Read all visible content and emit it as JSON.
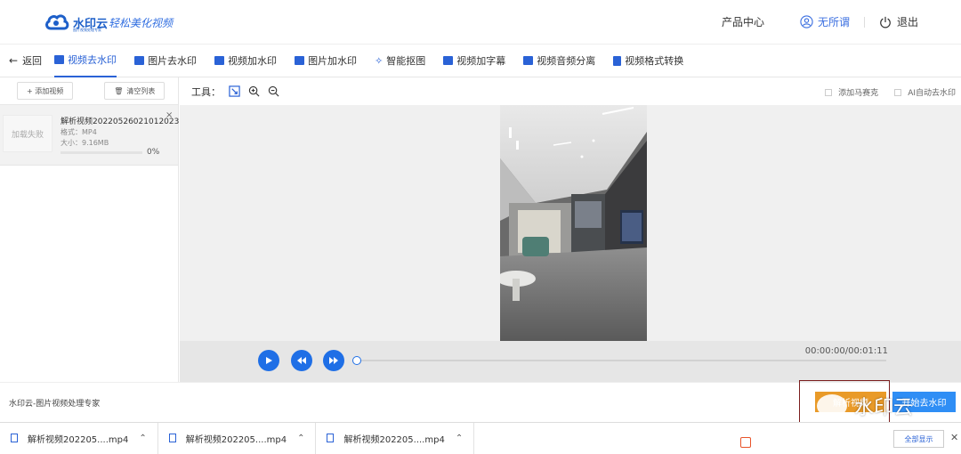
{
  "header": {
    "logo_text": "水印云",
    "logo_sub": "图片视频处理专家",
    "slogan": "轻松美化视频",
    "product_center": "产品中心",
    "username": "无所谓",
    "logout": "退出",
    "accent_color": "#2a62d6"
  },
  "tabs": {
    "back": "返回",
    "items": [
      {
        "label": "视频去水印",
        "icon": "video-icon"
      },
      {
        "label": "图片去水印",
        "icon": "image-icon"
      },
      {
        "label": "视频加水印",
        "icon": "video-icon"
      },
      {
        "label": "图片加水印",
        "icon": "image-icon"
      },
      {
        "label": "智能抠图",
        "icon": "magic-wand-icon"
      },
      {
        "label": "视频加字幕",
        "icon": "video-icon"
      },
      {
        "label": "视频音频分离",
        "icon": "video-icon"
      },
      {
        "label": "视频格式转换",
        "icon": "file-icon"
      }
    ]
  },
  "sidebar": {
    "add_video": "+ 添加视频",
    "clear_list": "清空列表",
    "file": {
      "thumb_status": "加载失败",
      "name": "解析视频20220526021012023...",
      "format": "格式：MP4",
      "size": "大小：9.16MB",
      "progress": "0%",
      "progress_value": 0
    }
  },
  "toolbar": {
    "label": "工具：",
    "options": [
      "添加马赛克",
      "AI自动去水印"
    ]
  },
  "player": {
    "time": "00:00:00/00:01:11",
    "progress_value": 0
  },
  "footer": {
    "text": "水印云-图片视频处理专家",
    "parse_button": "解析视频",
    "start_button": "开始去水印",
    "watermark_text": "水印云"
  },
  "downloads": {
    "items": [
      "解析视频202205....mp4",
      "解析视频202205....mp4",
      "解析视频202205....mp4"
    ],
    "show_all": "全部显示"
  }
}
